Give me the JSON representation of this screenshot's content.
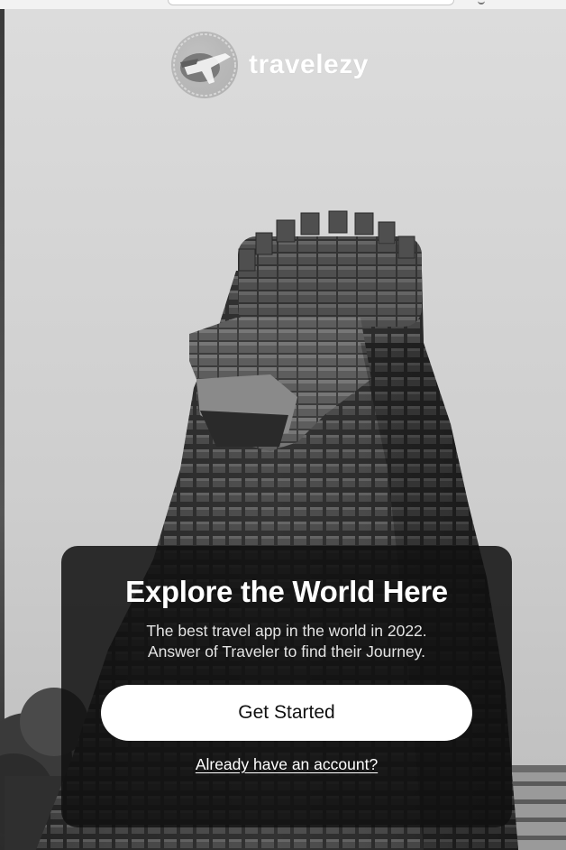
{
  "brand": {
    "name": "travelezy",
    "logo_icon": "globe-plane-icon"
  },
  "hero": {
    "image_subject": "stone-tower-icon"
  },
  "card": {
    "title": "Explore the World Here",
    "subtitle_line1": "The best travel app in the world in 2022.",
    "subtitle_line2": "Answer of Traveler to find their Journey.",
    "primary_button": "Get Started",
    "secondary_link": "Already have an account?"
  },
  "colors": {
    "card_bg": "#101010",
    "button_bg": "#ffffff",
    "text_light": "#ffffff"
  }
}
